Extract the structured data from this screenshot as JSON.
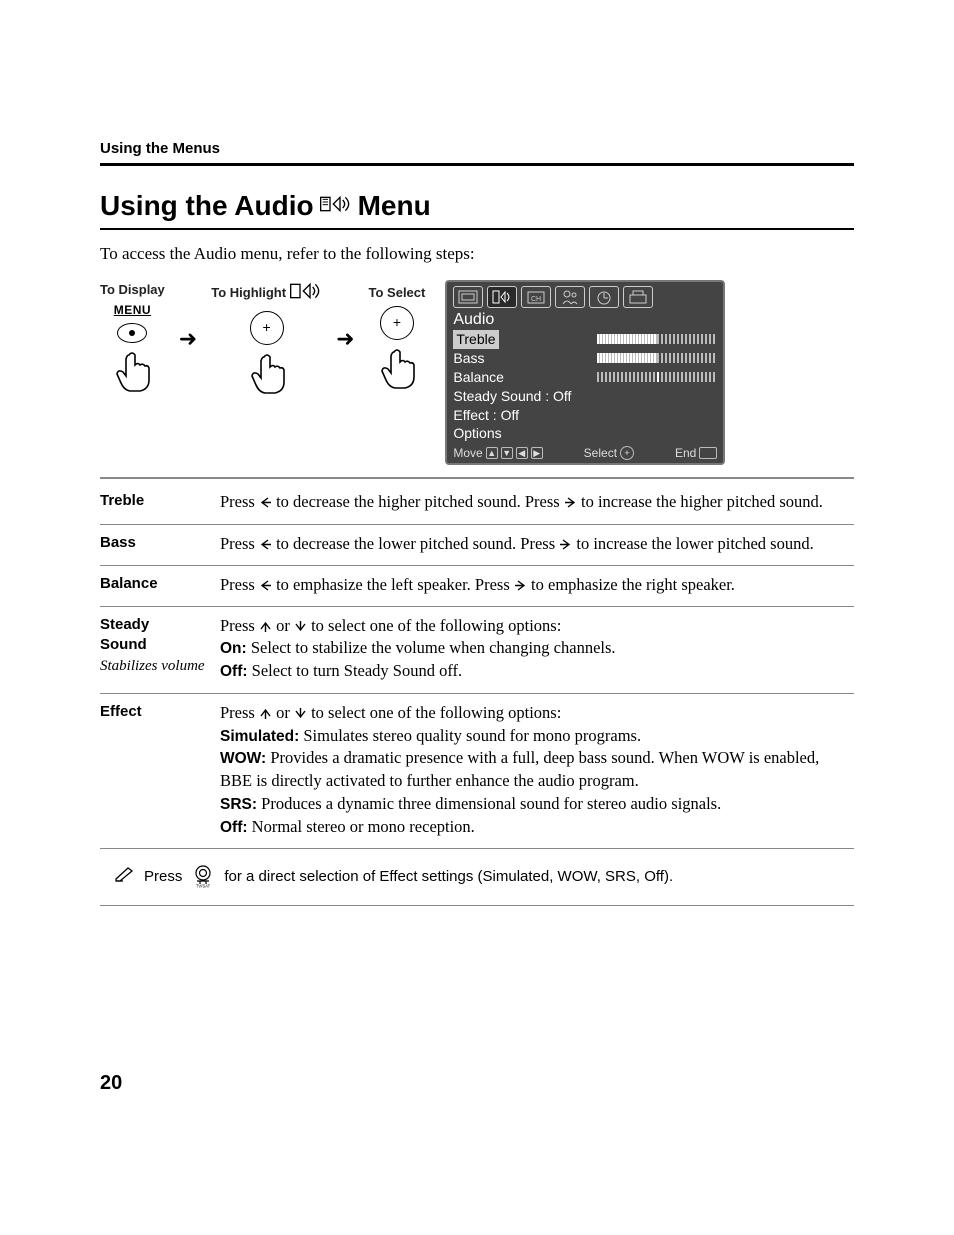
{
  "header": {
    "running": "Using the Menus"
  },
  "title": {
    "pre": "Using the Audio",
    "post": "Menu"
  },
  "intro": "To access the Audio menu, refer to the following steps:",
  "steps": {
    "display": "To Display",
    "menu_word": "MENU",
    "highlight": "To Highlight",
    "select": "To Select"
  },
  "osd": {
    "title": "Audio",
    "items": [
      {
        "label": "Treble",
        "type": "slider",
        "fill_pct": 50,
        "highlighted": true
      },
      {
        "label": "Bass",
        "type": "slider",
        "fill_pct": 50
      },
      {
        "label": "Balance",
        "type": "balance"
      },
      {
        "label": "Steady Sound : Off",
        "type": "text"
      },
      {
        "label": "Effect : Off",
        "type": "text"
      },
      {
        "label": "Options",
        "type": "text"
      }
    ],
    "footer": {
      "move": "Move",
      "select": "Select",
      "end": "End"
    }
  },
  "rows": {
    "treble": {
      "term": "Treble",
      "p1a": "Press ",
      "p1b": " to decrease the higher pitched sound. Press ",
      "p1c": " to increase the higher pitched sound."
    },
    "bass": {
      "term": "Bass",
      "p1a": "Press ",
      "p1b": " to decrease the lower pitched sound. Press ",
      "p1c": " to increase the lower pitched sound."
    },
    "balance": {
      "term": "Balance",
      "p1a": "Press ",
      "p1b": " to emphasize the left speaker. Press ",
      "p1c": " to emphasize the right speaker."
    },
    "steady": {
      "term1": "Steady",
      "term2": "Sound",
      "sub": "Stabilizes volume",
      "lead_a": "Press ",
      "lead_b": " or ",
      "lead_c": " to select one of the following options:",
      "on_l": "On:",
      "on_t": " Select to stabilize the volume when changing channels.",
      "off_l": "Off:",
      "off_t": " Select to turn Steady Sound off."
    },
    "effect": {
      "term": "Effect",
      "lead_a": "Press ",
      "lead_b": " or ",
      "lead_c": " to select one of the following options:",
      "sim_l": "Simulated:",
      "sim_t": " Simulates stereo quality sound for mono programs.",
      "wow_l": "WOW:",
      "wow_t": " Provides a dramatic presence with a full, deep bass sound. When WOW is enabled, BBE is directly activated to further enhance the audio program.",
      "srs_l": "SRS:",
      "srs_t": " Produces a dynamic three dimensional sound for stereo audio signals.",
      "off_l": "Off:",
      "off_t": " Normal stereo or mono reception."
    }
  },
  "tip": {
    "press": "Press",
    "text": "for a direct selection of Effect settings (Simulated, WOW, SRS, Off)."
  },
  "page_number": "20"
}
